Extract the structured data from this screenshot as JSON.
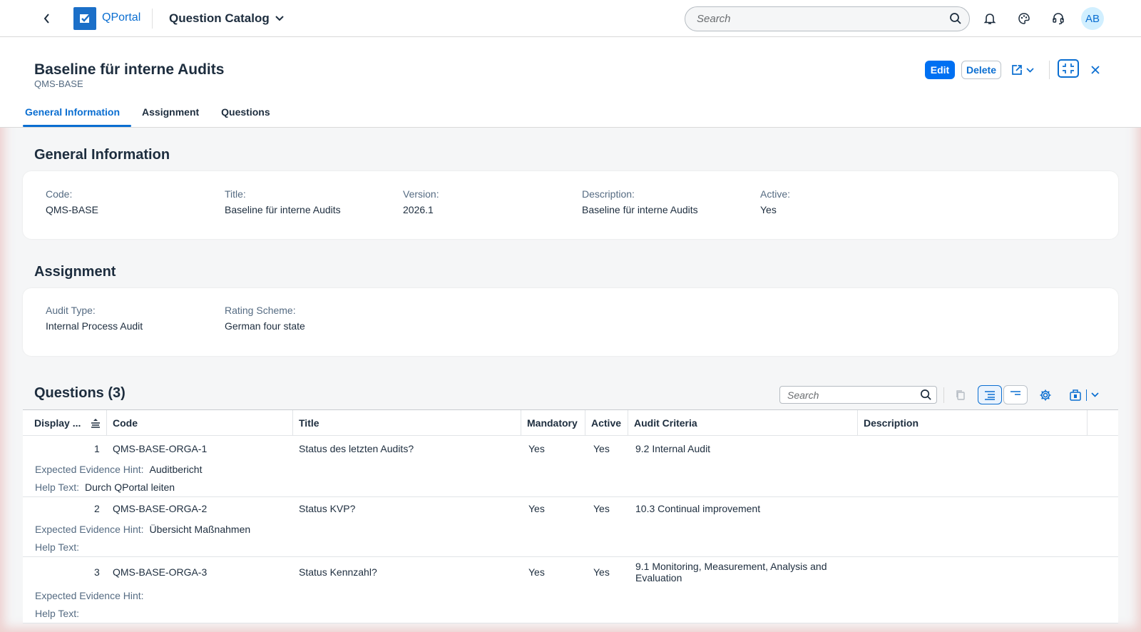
{
  "shell": {
    "app_name": "QPortal",
    "catalog_title": "Question Catalog",
    "search_placeholder": "Search",
    "avatar_initials": "AB"
  },
  "header": {
    "title": "Baseline für interne Audits",
    "subtitle": "QMS-BASE",
    "edit_label": "Edit",
    "delete_label": "Delete"
  },
  "tabs": [
    {
      "label": "General Information",
      "active": true
    },
    {
      "label": "Assignment",
      "active": false
    },
    {
      "label": "Questions",
      "active": false
    }
  ],
  "general": {
    "section_title": "General Information",
    "fields": [
      {
        "label": "Code:",
        "value": "QMS-BASE"
      },
      {
        "label": "Title:",
        "value": "Baseline für interne Audits"
      },
      {
        "label": "Version:",
        "value": "2026.1"
      },
      {
        "label": "Description:",
        "value": "Baseline für interne Audits"
      },
      {
        "label": "Active:",
        "value": "Yes"
      }
    ]
  },
  "assignment": {
    "section_title": "Assignment",
    "fields": [
      {
        "label": "Audit Type:",
        "value": "Internal Process Audit"
      },
      {
        "label": "Rating Scheme:",
        "value": "German four state"
      }
    ]
  },
  "questions": {
    "section_title": "Questions (3)",
    "search_placeholder": "Search",
    "columns": [
      "Display ...",
      "Code",
      "Title",
      "Mandatory",
      "Active",
      "Audit Criteria",
      "Description"
    ],
    "evidence_label": "Expected Evidence Hint:",
    "help_label": "Help Text:",
    "rows": [
      {
        "display": "1",
        "code": "QMS-BASE-ORGA-1",
        "title": "Status des letzten Audits?",
        "mandatory": "Yes",
        "active": "Yes",
        "criteria": "9.2 Internal Audit",
        "description": "",
        "evidence": "Auditbericht",
        "help": "Durch QPortal leiten"
      },
      {
        "display": "2",
        "code": "QMS-BASE-ORGA-2",
        "title": "Status KVP?",
        "mandatory": "Yes",
        "active": "Yes",
        "criteria": "10.3 Continual improvement",
        "description": "",
        "evidence": "Übersicht Maßnahmen",
        "help": ""
      },
      {
        "display": "3",
        "code": "QMS-BASE-ORGA-3",
        "title": "Status Kennzahl?",
        "mandatory": "Yes",
        "active": "Yes",
        "criteria": "9.1 Monitoring, Measurement, Analysis and Evaluation",
        "description": "",
        "evidence": "",
        "help": ""
      }
    ]
  },
  "colors": {
    "accent": "#0a6ed1",
    "emphasized_button": "#0070f2",
    "text": "#1d2d3e",
    "label": "#556b82"
  }
}
